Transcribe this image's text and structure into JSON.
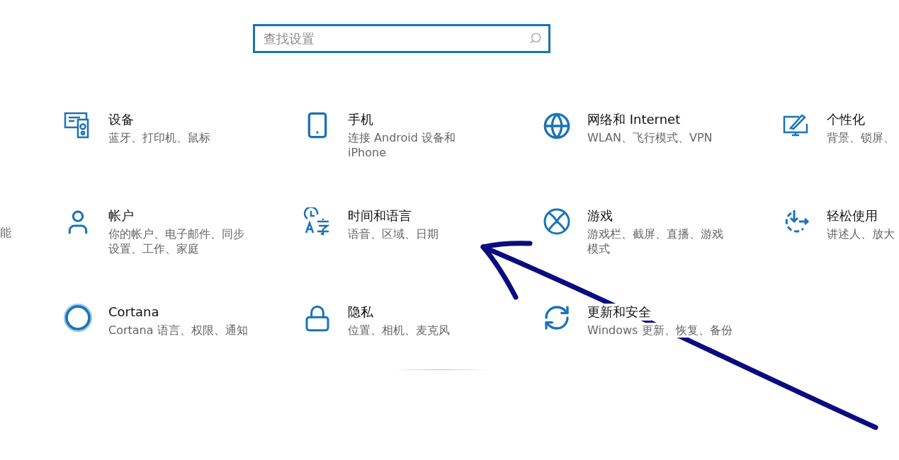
{
  "search": {
    "placeholder": "查找设置"
  },
  "left_edge": {
    "description": "能"
  },
  "tiles": [
    {
      "kind": "devices",
      "title": "设备",
      "description": "蓝牙、打印机、鼠标"
    },
    {
      "kind": "phone",
      "title": "手机",
      "description": "连接 Android 设备和 iPhone"
    },
    {
      "kind": "network",
      "title": "网络和 Internet",
      "description": "WLAN、飞行模式、VPN"
    },
    {
      "kind": "personalization",
      "title": "个性化",
      "description": "背景、锁屏、"
    },
    {
      "kind": "accounts",
      "title": "帐户",
      "description": "你的帐户、电子邮件、同步设置、工作、家庭"
    },
    {
      "kind": "time-language",
      "title": "时间和语言",
      "description": "语音、区域、日期"
    },
    {
      "kind": "gaming",
      "title": "游戏",
      "description": "游戏栏、截屏、直播、游戏模式"
    },
    {
      "kind": "ease-of-access",
      "title": "轻松使用",
      "description": "讲述人、放大"
    },
    {
      "kind": "cortana",
      "title": "Cortana",
      "description": "Cortana 语言、权限、通知"
    },
    {
      "kind": "privacy",
      "title": "隐私",
      "description": "位置、相机、麦克风"
    },
    {
      "kind": "update",
      "title": "更新和安全",
      "description": "Windows 更新、恢复、备份"
    }
  ]
}
